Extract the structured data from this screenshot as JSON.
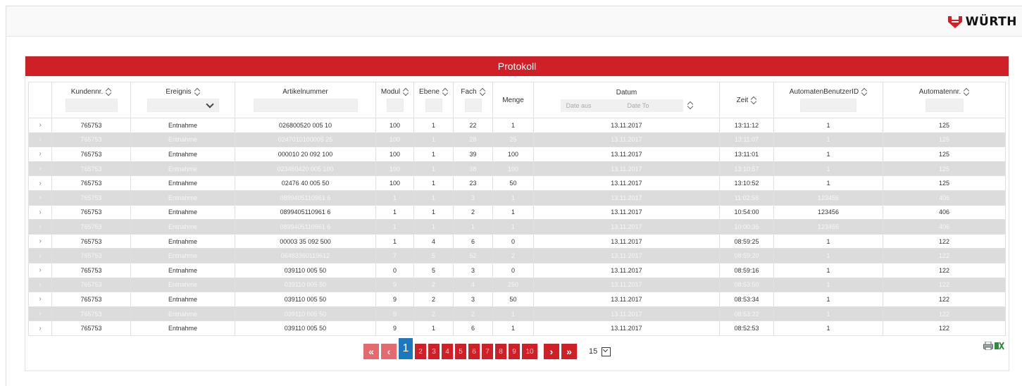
{
  "brand": {
    "name": "WÜRTH",
    "color": "#cf1f27"
  },
  "panel": {
    "title": "Protokoll"
  },
  "columns": {
    "kunde": "Kundennr.",
    "ereignis": "Ereignis",
    "artikel": "Artikelnummer",
    "modul": "Modul",
    "ebene": "Ebene",
    "fach": "Fach",
    "menge": "Menge",
    "datum": "Datum",
    "zeit": "Zeit",
    "benutzer": "AutomatenBenutzerID",
    "automat": "Automatennr."
  },
  "filters": {
    "date_from_placeholder": "Date aus",
    "date_to_placeholder": "Date To"
  },
  "rows": [
    {
      "kunde": "765753",
      "ereignis": "Entnahme",
      "artikel": "026800520 005 10",
      "modul": "100",
      "ebene": "1",
      "fach": "22",
      "menge": "1",
      "datum": "13.11.2017",
      "zeit": "13:11:12",
      "benutzer": "1",
      "automat": "125"
    },
    {
      "kunde": "765753",
      "ereignis": "Entnahme",
      "artikel": "0247010100005 25",
      "modul": "100",
      "ebene": "1",
      "fach": "28",
      "menge": "25",
      "datum": "13.11.2017",
      "zeit": "13:11:07",
      "benutzer": "1",
      "automat": "125"
    },
    {
      "kunde": "765753",
      "ereignis": "Entnahme",
      "artikel": "000010 20 092 100",
      "modul": "100",
      "ebene": "1",
      "fach": "39",
      "menge": "100",
      "datum": "13.11.2017",
      "zeit": "13:11:01",
      "benutzer": "1",
      "automat": "125"
    },
    {
      "kunde": "765753",
      "ereignis": "Entnahme",
      "artikel": "023460420 005 100",
      "modul": "100",
      "ebene": "1",
      "fach": "38",
      "menge": "100",
      "datum": "13.11.2017",
      "zeit": "13:10:57",
      "benutzer": "1",
      "automat": "125"
    },
    {
      "kunde": "765753",
      "ereignis": "Entnahme",
      "artikel": "02476 40 005 50",
      "modul": "100",
      "ebene": "1",
      "fach": "23",
      "menge": "50",
      "datum": "13.11.2017",
      "zeit": "13:10:52",
      "benutzer": "1",
      "automat": "125"
    },
    {
      "kunde": "765753",
      "ereignis": "Entnahme",
      "artikel": "0899405110961 6",
      "modul": "1",
      "ebene": "1",
      "fach": "3",
      "menge": "1",
      "datum": "13.11.2017",
      "zeit": "11:02:58",
      "benutzer": "123456",
      "automat": "406"
    },
    {
      "kunde": "765753",
      "ereignis": "Entnahme",
      "artikel": "0899405110961 6",
      "modul": "1",
      "ebene": "1",
      "fach": "2",
      "menge": "1",
      "datum": "13.11.2017",
      "zeit": "10:54:00",
      "benutzer": "123456",
      "automat": "406"
    },
    {
      "kunde": "765753",
      "ereignis": "Entnahme",
      "artikel": "0899405110961 6",
      "modul": "1",
      "ebene": "1",
      "fach": "1",
      "menge": "1",
      "datum": "13.11.2017",
      "zeit": "10:00:35",
      "benutzer": "123456",
      "automat": "406"
    },
    {
      "kunde": "765753",
      "ereignis": "Entnahme",
      "artikel": "00003 35 092 500",
      "modul": "1",
      "ebene": "4",
      "fach": "6",
      "menge": "0",
      "datum": "13.11.2017",
      "zeit": "08:59:25",
      "benutzer": "1",
      "automat": "122"
    },
    {
      "kunde": "765753",
      "ereignis": "Entnahme",
      "artikel": "06483360119612",
      "modul": "7",
      "ebene": "5",
      "fach": "52",
      "menge": "2",
      "datum": "13.11.2017",
      "zeit": "08:59:20",
      "benutzer": "1",
      "automat": "122"
    },
    {
      "kunde": "765753",
      "ereignis": "Entnahme",
      "artikel": "039110 005 50",
      "modul": "0",
      "ebene": "5",
      "fach": "3",
      "menge": "0",
      "datum": "13.11.2017",
      "zeit": "08:59:16",
      "benutzer": "1",
      "automat": "122"
    },
    {
      "kunde": "765753",
      "ereignis": "Entnahme",
      "artikel": "039110 005 50",
      "modul": "9",
      "ebene": "2",
      "fach": "4",
      "menge": "250",
      "datum": "13.11.2017",
      "zeit": "08:53:50",
      "benutzer": "1",
      "automat": "122"
    },
    {
      "kunde": "765753",
      "ereignis": "Entnahme",
      "artikel": "039110 005 50",
      "modul": "9",
      "ebene": "2",
      "fach": "3",
      "menge": "50",
      "datum": "13.11.2017",
      "zeit": "08:53:34",
      "benutzer": "1",
      "automat": "122"
    },
    {
      "kunde": "765753",
      "ereignis": "Entnahme",
      "artikel": "039110 005 50",
      "modul": "9",
      "ebene": "2",
      "fach": "2",
      "menge": "1",
      "datum": "13.11.2017",
      "zeit": "08:53:22",
      "benutzer": "1",
      "automat": "122"
    },
    {
      "kunde": "765753",
      "ereignis": "Entnahme",
      "artikel": "039110 005 50",
      "modul": "9",
      "ebene": "1",
      "fach": "6",
      "menge": "1",
      "datum": "13.11.2017",
      "zeit": "08:52:53",
      "benutzer": "1",
      "automat": "122"
    }
  ],
  "pagination": {
    "first": "«",
    "prev": "‹",
    "next": "›",
    "last": "»",
    "active": "1",
    "pages": [
      "2",
      "3",
      "4",
      "5",
      "6",
      "7",
      "8",
      "9",
      "10"
    ],
    "page_size": "15"
  },
  "icons": {
    "expand": "chevron-right-icon",
    "sort": "sort-icon",
    "print": "print-icon",
    "excel": "excel-icon"
  }
}
